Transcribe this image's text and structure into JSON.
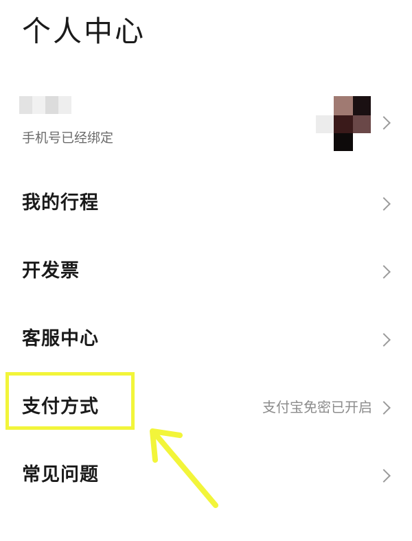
{
  "header": {
    "title": "个人中心"
  },
  "profile": {
    "phone_status": "手机号已经绑定"
  },
  "menu": {
    "items": [
      {
        "label": "我的行程",
        "value": ""
      },
      {
        "label": "开发票",
        "value": ""
      },
      {
        "label": "客服中心",
        "value": ""
      },
      {
        "label": "支付方式",
        "value": "支付宝免密已开启"
      },
      {
        "label": "常见问题",
        "value": ""
      }
    ]
  },
  "icons": {
    "row_chevron": "chevron-right-icon",
    "annotation_arrow": "arrow-icon"
  },
  "colors": {
    "highlight": "#f2f53a",
    "secondary_text": "#8c8c8c",
    "chevron": "#9a9a9a"
  }
}
